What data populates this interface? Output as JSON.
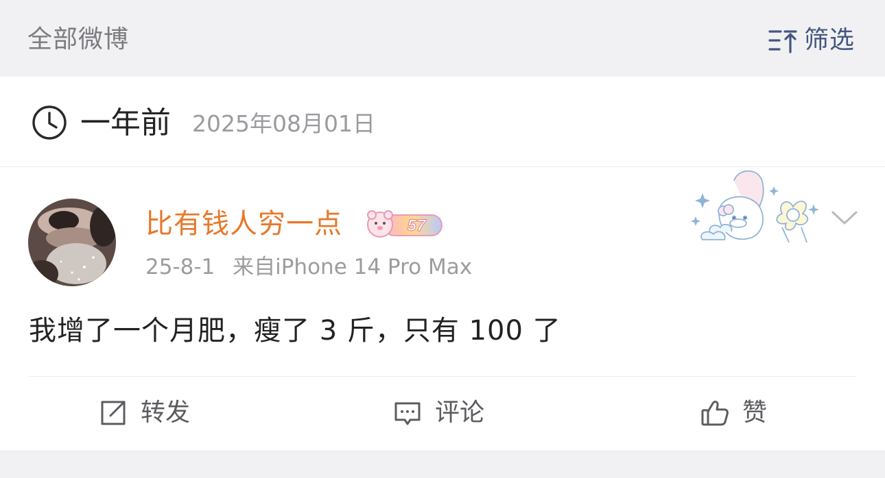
{
  "filter_bar": {
    "title": "全部微博",
    "filter_label": "筛选",
    "filter_icon": "sort-up-icon"
  },
  "time_header": {
    "relative": "一年前",
    "date": "2025年08月01日",
    "icon": "clock-icon"
  },
  "post": {
    "username": "比有钱人穷一点",
    "vip_badge_level": "57",
    "date": "25-8-1",
    "source": "来自iPhone 14 Pro Max",
    "text": "我增了一个月肥，瘦了 3 斤，只有 100 了",
    "colors": {
      "username": "#e8782b",
      "meta": "#9c9c9f",
      "text": "#222222"
    }
  },
  "actions": {
    "repost": "转发",
    "comment": "评论",
    "like": "赞"
  }
}
